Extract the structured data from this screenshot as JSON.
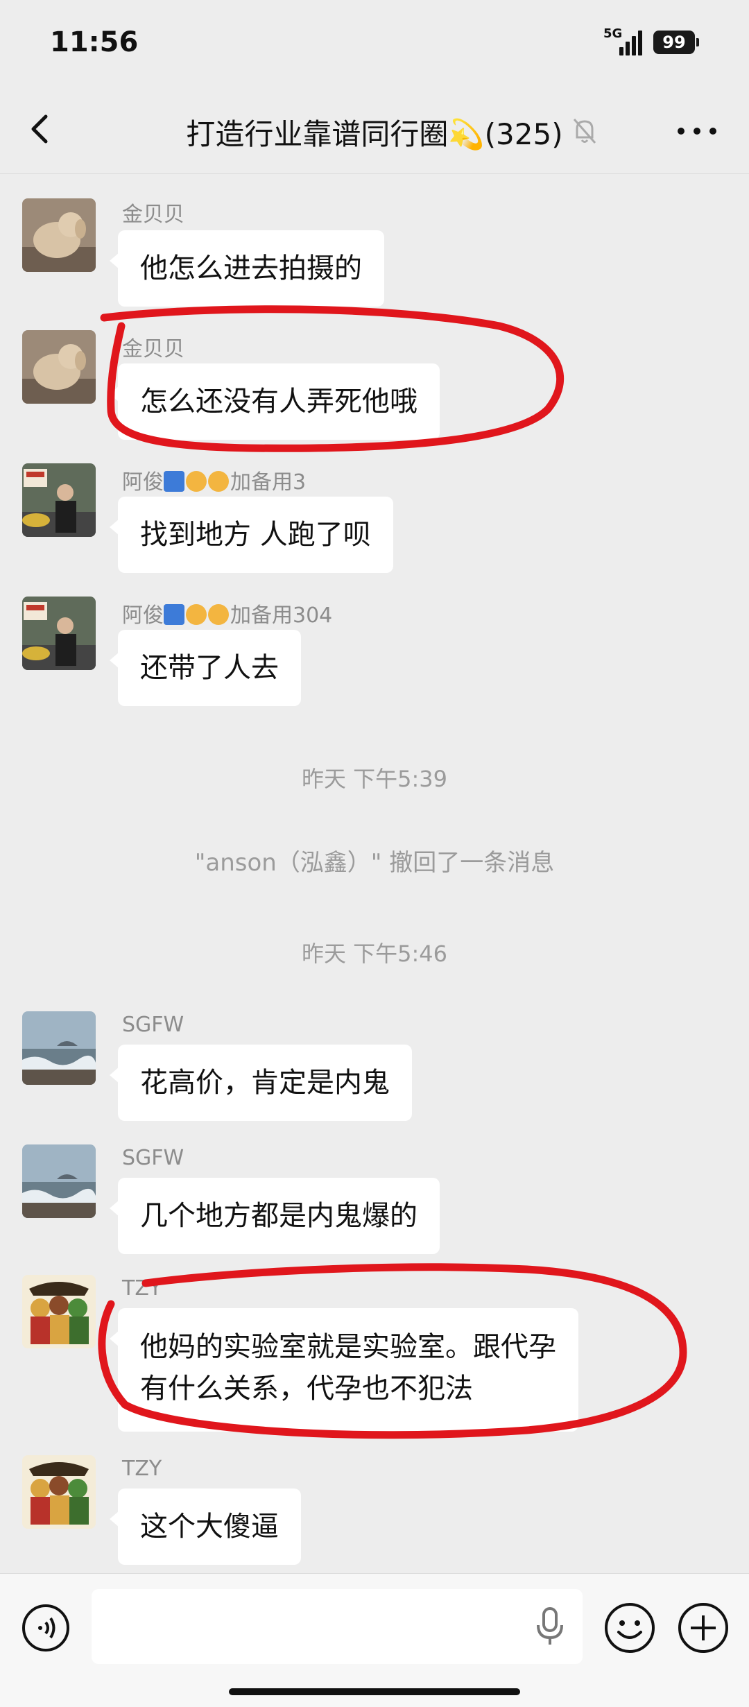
{
  "status_bar": {
    "time": "11:56",
    "network": "5G",
    "battery": "99"
  },
  "header": {
    "title": "打造行业靠谱同行圈💫(325)",
    "icons": [
      "back-arrow-icon",
      "mute-bell-icon",
      "more-dots-icon"
    ]
  },
  "messages": [
    {
      "sender": "金贝贝",
      "text": "他怎么进去拍摄的",
      "avatar": "plush-dog"
    },
    {
      "sender": "金贝贝",
      "text": "怎么还没有人弄死他哦",
      "avatar": "plush-dog"
    },
    {
      "sender": "阿俊",
      "sender_suffix": "加备用3",
      "text": "找到地方 人跑了呗",
      "avatar": "man-street"
    },
    {
      "sender": "阿俊",
      "sender_suffix": "加备用304",
      "text": "还带了人去",
      "avatar": "man-street"
    },
    {
      "sender": "SGFW",
      "text": "花高价，肯定是内鬼",
      "avatar": "sea-waves"
    },
    {
      "sender": "SGFW",
      "text": "几个地方都是内鬼爆的",
      "avatar": "sea-waves"
    },
    {
      "sender": "TZY",
      "text_line1": "他妈的实验室就是实验室。跟代孕",
      "text_line2": "有什么关系，代孕也不犯法",
      "avatar": "cartoon-group"
    },
    {
      "sender": "TZY",
      "text": "这个大傻逼",
      "avatar": "cartoon-group"
    }
  ],
  "system": {
    "time1": "昨天  下午5:39",
    "recall": "\"anson（泓鑫）\" 撤回了一条消息",
    "time2": "昨天  下午5:46"
  },
  "input_bar": {
    "icons": [
      "voice-icon",
      "mic-icon",
      "emoji-icon",
      "plus-icon"
    ]
  },
  "colors": {
    "background": "#ededed",
    "bubble": "#ffffff",
    "annotation": "#e0161c",
    "system_text": "#9b9b9b"
  }
}
